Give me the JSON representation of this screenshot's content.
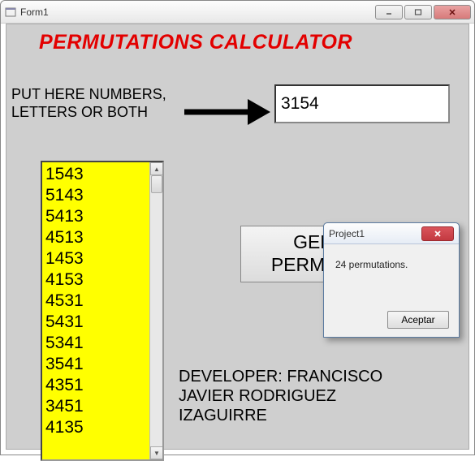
{
  "main_window": {
    "title": "Form1"
  },
  "heading": "PERMUTATIONS CALCULATOR",
  "prompt": "PUT HERE NUMBERS,\nLETTERS OR BOTH",
  "input_value": "3154",
  "generate_label": "GENERATE\nPERMUTATIONS",
  "developer_credit": "DEVELOPER: FRANCISCO\nJAVIER RODRIGUEZ\nIZAGUIRRE",
  "listbox": {
    "items": [
      "1543",
      "5143",
      "5413",
      "4513",
      "1453",
      "4153",
      "4531",
      "5431",
      "5341",
      "3541",
      "4351",
      "3451",
      "4135"
    ]
  },
  "dialog": {
    "title": "Project1",
    "message": "24 permutations.",
    "ok_label": "Aceptar"
  }
}
